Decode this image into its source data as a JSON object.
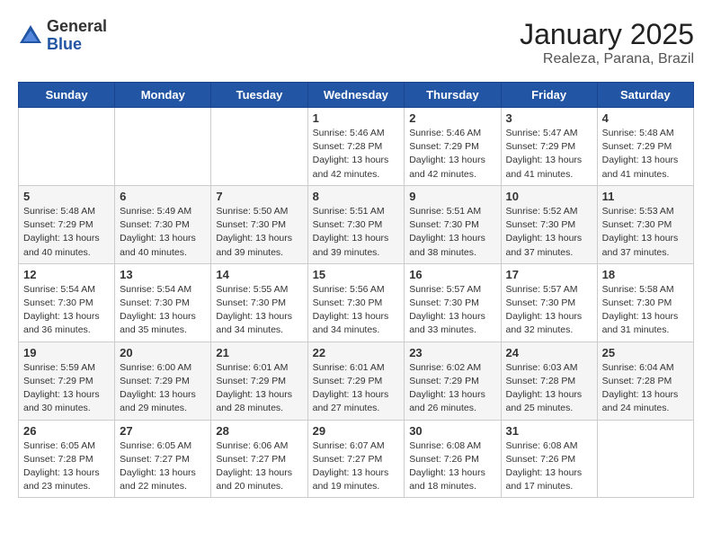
{
  "logo": {
    "general": "General",
    "blue": "Blue"
  },
  "header": {
    "title": "January 2025",
    "location": "Realeza, Parana, Brazil"
  },
  "days_of_week": [
    "Sunday",
    "Monday",
    "Tuesday",
    "Wednesday",
    "Thursday",
    "Friday",
    "Saturday"
  ],
  "weeks": [
    [
      {
        "num": "",
        "info": ""
      },
      {
        "num": "",
        "info": ""
      },
      {
        "num": "",
        "info": ""
      },
      {
        "num": "1",
        "info": "Sunrise: 5:46 AM\nSunset: 7:28 PM\nDaylight: 13 hours\nand 42 minutes."
      },
      {
        "num": "2",
        "info": "Sunrise: 5:46 AM\nSunset: 7:29 PM\nDaylight: 13 hours\nand 42 minutes."
      },
      {
        "num": "3",
        "info": "Sunrise: 5:47 AM\nSunset: 7:29 PM\nDaylight: 13 hours\nand 41 minutes."
      },
      {
        "num": "4",
        "info": "Sunrise: 5:48 AM\nSunset: 7:29 PM\nDaylight: 13 hours\nand 41 minutes."
      }
    ],
    [
      {
        "num": "5",
        "info": "Sunrise: 5:48 AM\nSunset: 7:29 PM\nDaylight: 13 hours\nand 40 minutes."
      },
      {
        "num": "6",
        "info": "Sunrise: 5:49 AM\nSunset: 7:30 PM\nDaylight: 13 hours\nand 40 minutes."
      },
      {
        "num": "7",
        "info": "Sunrise: 5:50 AM\nSunset: 7:30 PM\nDaylight: 13 hours\nand 39 minutes."
      },
      {
        "num": "8",
        "info": "Sunrise: 5:51 AM\nSunset: 7:30 PM\nDaylight: 13 hours\nand 39 minutes."
      },
      {
        "num": "9",
        "info": "Sunrise: 5:51 AM\nSunset: 7:30 PM\nDaylight: 13 hours\nand 38 minutes."
      },
      {
        "num": "10",
        "info": "Sunrise: 5:52 AM\nSunset: 7:30 PM\nDaylight: 13 hours\nand 37 minutes."
      },
      {
        "num": "11",
        "info": "Sunrise: 5:53 AM\nSunset: 7:30 PM\nDaylight: 13 hours\nand 37 minutes."
      }
    ],
    [
      {
        "num": "12",
        "info": "Sunrise: 5:54 AM\nSunset: 7:30 PM\nDaylight: 13 hours\nand 36 minutes."
      },
      {
        "num": "13",
        "info": "Sunrise: 5:54 AM\nSunset: 7:30 PM\nDaylight: 13 hours\nand 35 minutes."
      },
      {
        "num": "14",
        "info": "Sunrise: 5:55 AM\nSunset: 7:30 PM\nDaylight: 13 hours\nand 34 minutes."
      },
      {
        "num": "15",
        "info": "Sunrise: 5:56 AM\nSunset: 7:30 PM\nDaylight: 13 hours\nand 34 minutes."
      },
      {
        "num": "16",
        "info": "Sunrise: 5:57 AM\nSunset: 7:30 PM\nDaylight: 13 hours\nand 33 minutes."
      },
      {
        "num": "17",
        "info": "Sunrise: 5:57 AM\nSunset: 7:30 PM\nDaylight: 13 hours\nand 32 minutes."
      },
      {
        "num": "18",
        "info": "Sunrise: 5:58 AM\nSunset: 7:30 PM\nDaylight: 13 hours\nand 31 minutes."
      }
    ],
    [
      {
        "num": "19",
        "info": "Sunrise: 5:59 AM\nSunset: 7:29 PM\nDaylight: 13 hours\nand 30 minutes."
      },
      {
        "num": "20",
        "info": "Sunrise: 6:00 AM\nSunset: 7:29 PM\nDaylight: 13 hours\nand 29 minutes."
      },
      {
        "num": "21",
        "info": "Sunrise: 6:01 AM\nSunset: 7:29 PM\nDaylight: 13 hours\nand 28 minutes."
      },
      {
        "num": "22",
        "info": "Sunrise: 6:01 AM\nSunset: 7:29 PM\nDaylight: 13 hours\nand 27 minutes."
      },
      {
        "num": "23",
        "info": "Sunrise: 6:02 AM\nSunset: 7:29 PM\nDaylight: 13 hours\nand 26 minutes."
      },
      {
        "num": "24",
        "info": "Sunrise: 6:03 AM\nSunset: 7:28 PM\nDaylight: 13 hours\nand 25 minutes."
      },
      {
        "num": "25",
        "info": "Sunrise: 6:04 AM\nSunset: 7:28 PM\nDaylight: 13 hours\nand 24 minutes."
      }
    ],
    [
      {
        "num": "26",
        "info": "Sunrise: 6:05 AM\nSunset: 7:28 PM\nDaylight: 13 hours\nand 23 minutes."
      },
      {
        "num": "27",
        "info": "Sunrise: 6:05 AM\nSunset: 7:27 PM\nDaylight: 13 hours\nand 22 minutes."
      },
      {
        "num": "28",
        "info": "Sunrise: 6:06 AM\nSunset: 7:27 PM\nDaylight: 13 hours\nand 20 minutes."
      },
      {
        "num": "29",
        "info": "Sunrise: 6:07 AM\nSunset: 7:27 PM\nDaylight: 13 hours\nand 19 minutes."
      },
      {
        "num": "30",
        "info": "Sunrise: 6:08 AM\nSunset: 7:26 PM\nDaylight: 13 hours\nand 18 minutes."
      },
      {
        "num": "31",
        "info": "Sunrise: 6:08 AM\nSunset: 7:26 PM\nDaylight: 13 hours\nand 17 minutes."
      },
      {
        "num": "",
        "info": ""
      }
    ]
  ]
}
